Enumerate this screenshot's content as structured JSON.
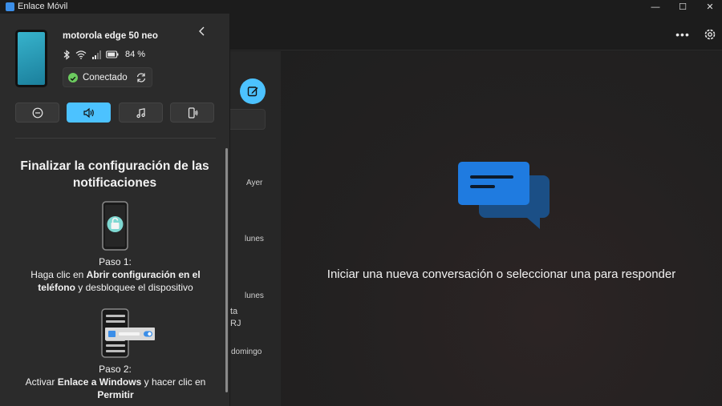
{
  "window": {
    "title": "Enlace Móvil",
    "minimize": "—",
    "maximize": "☐",
    "close": "✕"
  },
  "header": {
    "more": "•••"
  },
  "device": {
    "name": "motorola edge 50 neo",
    "battery": "84 %",
    "connection_status": "Conectado"
  },
  "modes": [
    {
      "icon": "do-not-disturb-icon",
      "active": false
    },
    {
      "icon": "sound-icon",
      "active": true
    },
    {
      "icon": "music-note-icon",
      "active": false
    },
    {
      "icon": "phone-audio-icon",
      "active": false
    }
  ],
  "notifications": {
    "title": "Finalizar la configuración de las notificaciones",
    "step1_label": "Paso 1:",
    "step1_pre": "Haga clic en ",
    "step1_bold1": "Abrir configuración en el teléfono",
    "step1_post": " y desbloquee el dispositivo",
    "step2_label": "Paso 2:",
    "step2_pre": "Activar ",
    "step2_bold1": "Enlace a Windows",
    "step2_mid": " y hacer clic en ",
    "step2_bold2": "Permitir"
  },
  "conversations": {
    "dates": [
      "Ayer",
      "lunes",
      "lunes",
      "domingo"
    ],
    "fragments": [
      "ta",
      "RJ"
    ]
  },
  "main": {
    "empty_message": "Iniciar una nueva conversación o seleccionar una para responder"
  },
  "colors": {
    "accent": "#4cc2ff",
    "connected": "#6ccb5f",
    "chat_bubble_front": "#1f7be0",
    "chat_bubble_back": "#1b4f86"
  }
}
